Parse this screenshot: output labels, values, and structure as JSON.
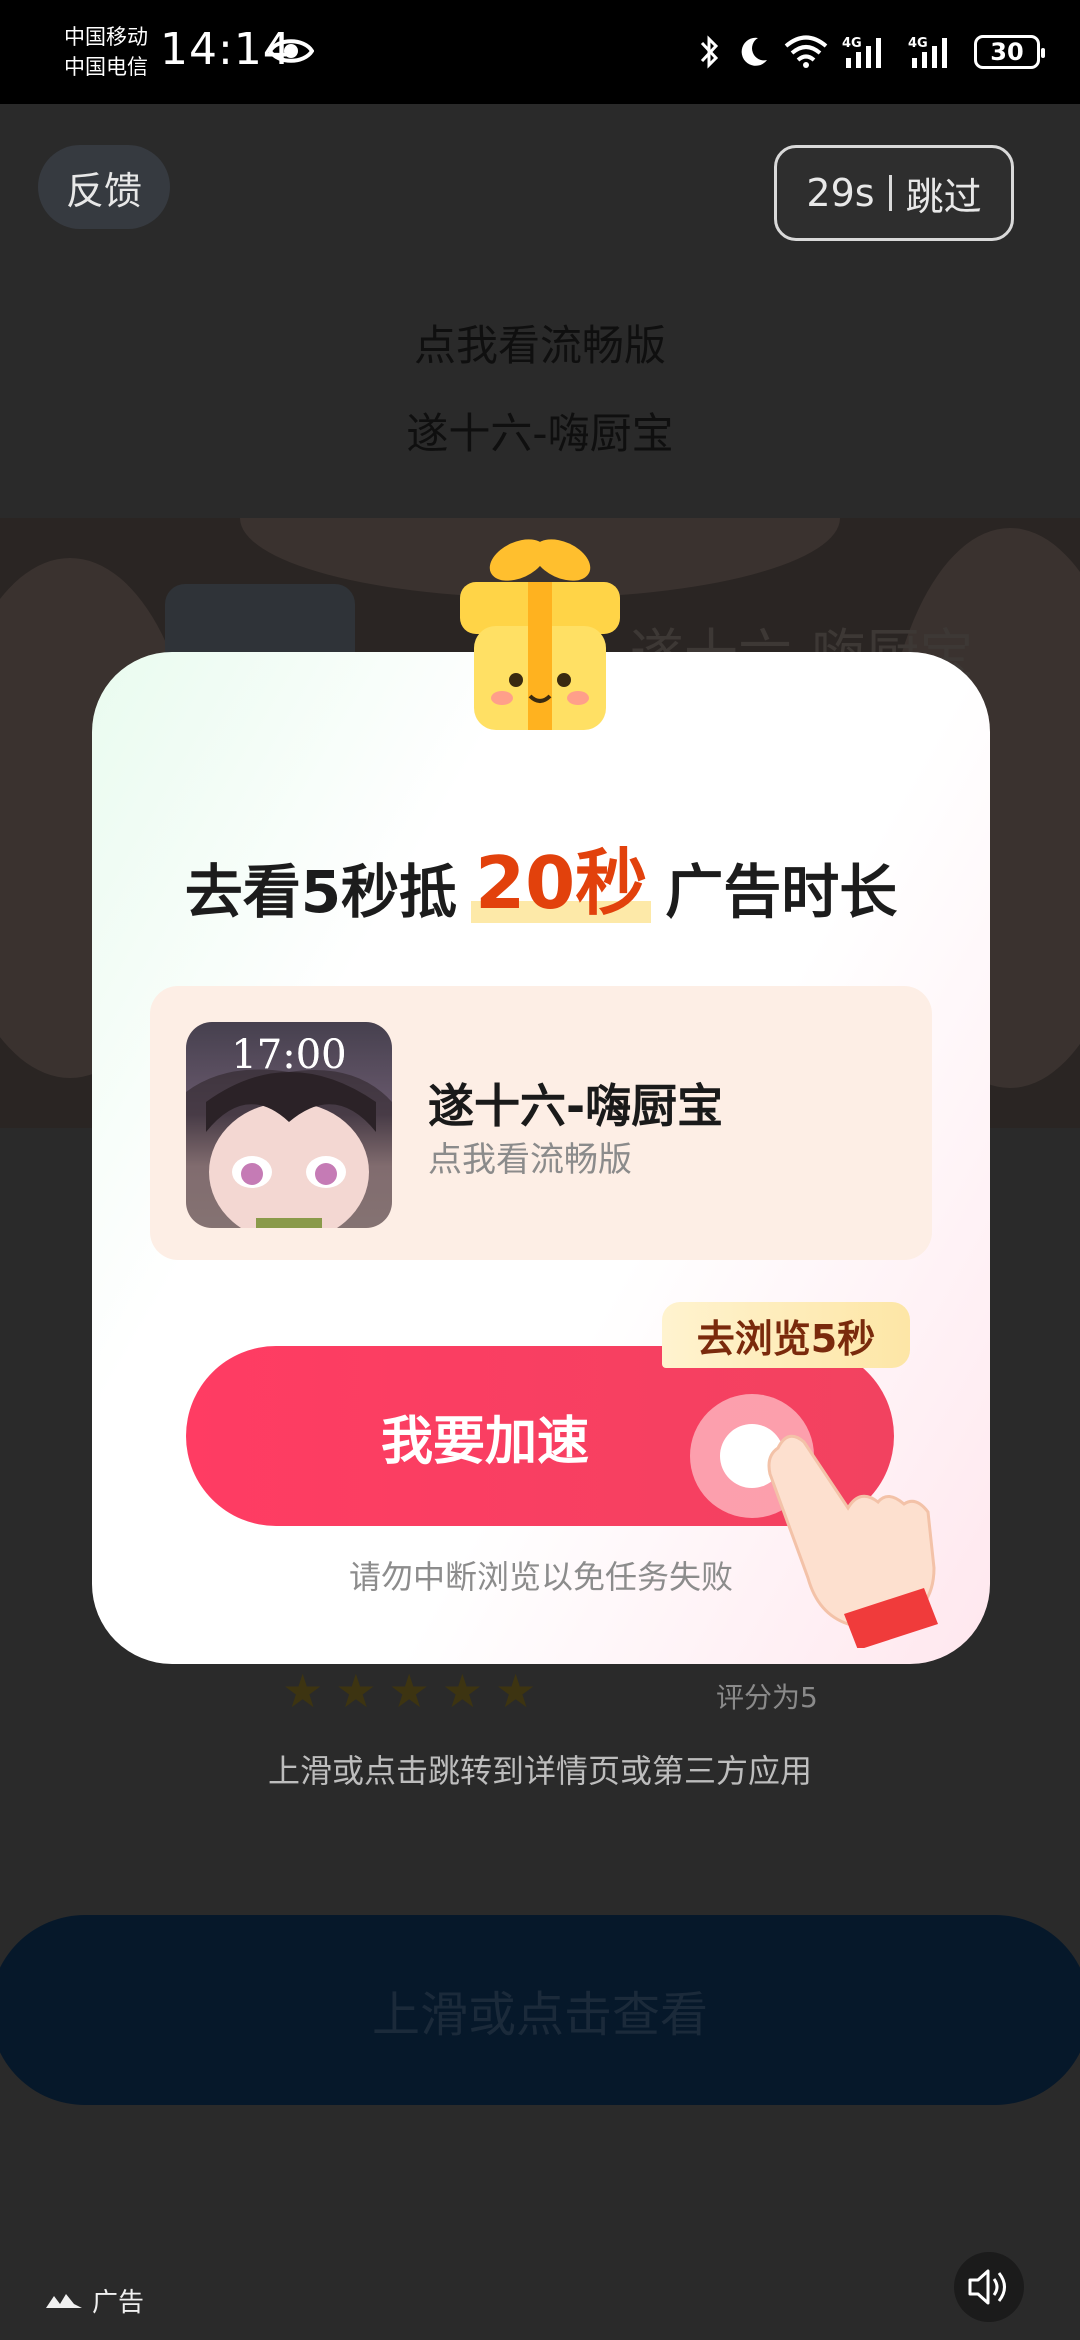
{
  "status_bar": {
    "carrier_1": "中国移动",
    "carrier_2": "中国电信",
    "time": "14:14",
    "battery": "30",
    "icons": [
      "eye-icon",
      "bluetooth-icon",
      "moon-icon",
      "wifi-icon",
      "signal-4g-icon",
      "signal-4g-icon",
      "battery-icon"
    ]
  },
  "header": {
    "feedback": "反馈",
    "countdown": "29s",
    "skip": "跳过"
  },
  "background": {
    "subtitle": "点我看流畅版",
    "title": "遂十六-嗨厨宝",
    "rating_text": "评分为5",
    "stars": 5,
    "swipe_hint": "上滑或点击跳转到详情页或第三方应用",
    "swipe_button": "上滑或点击查看",
    "ad_label": "广告"
  },
  "modal": {
    "title_prefix": "去看5秒抵",
    "title_highlight": "20秒",
    "title_suffix": "广告时长",
    "app": {
      "thumb_time": "17:00",
      "name": "遂十六-嗨厨宝",
      "subtitle": "点我看流畅版"
    },
    "tag": "去浏览5秒",
    "cta": "我要加速",
    "warning": "请勿中断浏览以免任务失败"
  },
  "colors": {
    "cta": "#ff3c63",
    "highlight": "#e2410c",
    "swipe_button": "#06182a"
  }
}
